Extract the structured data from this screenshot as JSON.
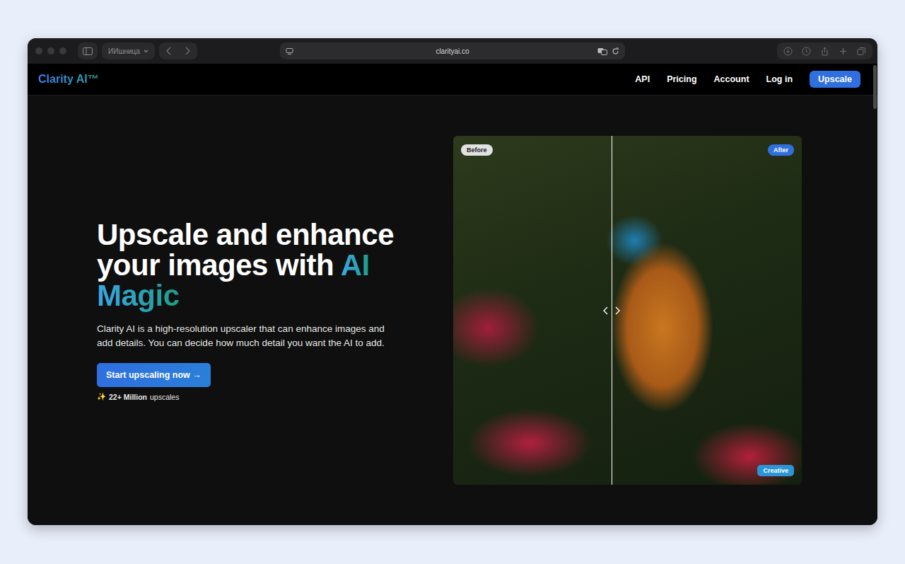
{
  "browser": {
    "profile": "ИИшница",
    "url": "clarityai.co"
  },
  "nav": {
    "logo": "Clarity AI™",
    "links": [
      "API",
      "Pricing",
      "Account",
      "Log in"
    ],
    "cta": "Upscale"
  },
  "hero": {
    "title": "Upscale and enhance your images with",
    "title_highlight": "AI Magic",
    "description": "Clarity AI is a high-resolution upscaler that can enhance images and add details. You can decide how much detail you want the AI to add.",
    "cta": "Start upscaling now →",
    "stats": {
      "icon": "✨",
      "count": "22+ Million",
      "label": "upscales"
    }
  },
  "comparison": {
    "before_label": "Before",
    "after_label": "After",
    "mode_label": "Creative",
    "level": 0.455
  }
}
